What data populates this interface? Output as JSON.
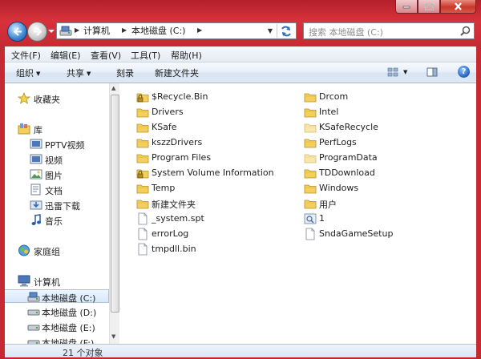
{
  "window": {
    "caption_buttons": [
      "minimize",
      "maximize",
      "close"
    ]
  },
  "address": {
    "crumbs": [
      "计算机",
      "本地磁盘 (C:)"
    ]
  },
  "search": {
    "placeholder": "搜索 本地磁盘 (C:)"
  },
  "menu": [
    "文件(F)",
    "编辑(E)",
    "查看(V)",
    "工具(T)",
    "帮助(H)"
  ],
  "toolbar": {
    "organize": "组织",
    "share": "共享",
    "burn": "刻录",
    "new_folder": "新建文件夹",
    "help": "?"
  },
  "nav": {
    "favorites": "收藏夹",
    "libraries": "库",
    "library_items": [
      "PPTV视频",
      "视频",
      "图片",
      "文档",
      "迅雷下载",
      "音乐"
    ],
    "homegroup": "家庭组",
    "computer": "计算机",
    "drives": [
      "本地磁盘 (C:)",
      "本地磁盘 (D:)",
      "本地磁盘 (E:)",
      "本地磁盘 (F:)"
    ]
  },
  "files": {
    "col1": [
      {
        "name": "$Recycle.Bin",
        "icon": "locked-folder-icon"
      },
      {
        "name": "Drivers",
        "icon": "folder-icon"
      },
      {
        "name": "KSafe",
        "icon": "folder-icon"
      },
      {
        "name": "kszzDrivers",
        "icon": "folder-icon"
      },
      {
        "name": "Program Files",
        "icon": "folder-icon"
      },
      {
        "name": "System Volume Information",
        "icon": "locked-folder-icon"
      },
      {
        "name": "Temp",
        "icon": "folder-icon"
      },
      {
        "name": "新建文件夹",
        "icon": "folder-icon"
      },
      {
        "name": "_system.spt",
        "icon": "file-icon"
      },
      {
        "name": "errorLog",
        "icon": "file-icon"
      },
      {
        "name": "tmpdll.bin",
        "icon": "file-icon"
      }
    ],
    "col2": [
      {
        "name": "Drcom",
        "icon": "folder-icon"
      },
      {
        "name": "Intel",
        "icon": "folder-icon"
      },
      {
        "name": "KSafeRecycle",
        "icon": "hidden-folder-icon"
      },
      {
        "name": "PerfLogs",
        "icon": "folder-icon"
      },
      {
        "name": "ProgramData",
        "icon": "hidden-folder-icon"
      },
      {
        "name": "TDDownload",
        "icon": "folder-icon"
      },
      {
        "name": "Windows",
        "icon": "folder-icon"
      },
      {
        "name": "用户",
        "icon": "folder-icon"
      },
      {
        "name": "1",
        "icon": "image-file-icon"
      },
      {
        "name": "SndaGameSetup",
        "icon": "file-icon"
      }
    ]
  },
  "status": {
    "count": "21 个对象"
  },
  "colors": {
    "frame": "#c0262e",
    "selection": "#d7e7fa",
    "folder": "#f3cf5c"
  }
}
